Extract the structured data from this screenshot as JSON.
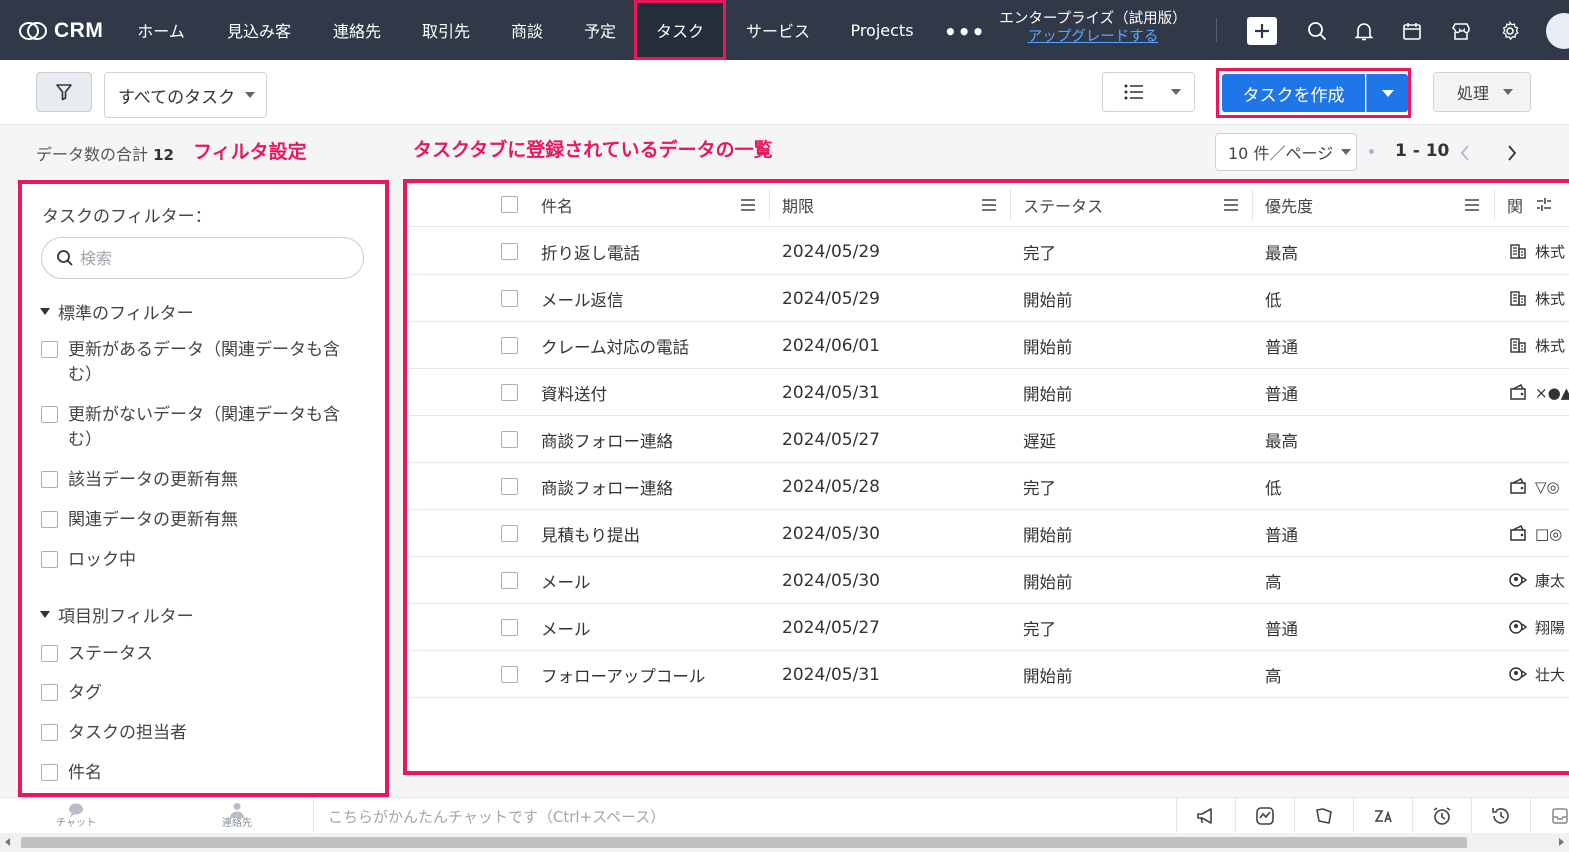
{
  "app": {
    "logo_text": "CRM"
  },
  "nav": {
    "items": [
      {
        "label": "ホーム"
      },
      {
        "label": "見込み客"
      },
      {
        "label": "連絡先"
      },
      {
        "label": "取引先"
      },
      {
        "label": "商談"
      },
      {
        "label": "予定"
      },
      {
        "label": "タスク",
        "active": true
      },
      {
        "label": "サービス"
      },
      {
        "label": "Projects"
      }
    ],
    "more_label": "•••",
    "trial_label": "エンタープライズ（試用版）",
    "upgrade_link": "アップグレードする",
    "icons": [
      "plus-icon",
      "search-icon",
      "bell-icon",
      "calendar-icon",
      "store-icon",
      "gear-icon"
    ]
  },
  "toolbar": {
    "view_select": "すべてのタスク",
    "create_button": "タスクを作成",
    "action_button": "処理"
  },
  "summary": {
    "total_label": "データ数の合計",
    "total_count": "12",
    "annotation_filter": "フィルタ設定",
    "annotation_list": "タスクタブに登録されているデータの一覧"
  },
  "pagination": {
    "per_page": "10 件／ページ",
    "range": "1 - 10"
  },
  "filter_panel": {
    "title": "タスクのフィルター：",
    "search_placeholder": "検索",
    "section_standard": "標準のフィルター",
    "standard_items": [
      "更新があるデータ（関連データも含む）",
      "更新がないデータ（関連データも含む）",
      "該当データの更新有無",
      "関連データの更新有無",
      "ロック中"
    ],
    "section_field": "項目別フィルター",
    "field_items": [
      "ステータス",
      "タグ",
      "タスクの担当者",
      "件名"
    ]
  },
  "grid": {
    "columns": [
      "件名",
      "期限",
      "ステータス",
      "優先度",
      "関"
    ],
    "rows": [
      {
        "subject": "折り返し電話",
        "due": "2024/05/29",
        "status": "完了",
        "priority": "最高",
        "rel_icon": "building-icon",
        "rel_text": "株式"
      },
      {
        "subject": "メール返信",
        "due": "2024/05/29",
        "status": "開始前",
        "priority": "低",
        "rel_icon": "building-icon",
        "rel_text": "株式"
      },
      {
        "subject": "クレーム対応の電話",
        "due": "2024/06/01",
        "status": "開始前",
        "priority": "普通",
        "rel_icon": "building-icon",
        "rel_text": "株式"
      },
      {
        "subject": "資料送付",
        "due": "2024/05/31",
        "status": "開始前",
        "priority": "普通",
        "rel_icon": "wallet-icon",
        "rel_text": "×●▲"
      },
      {
        "subject": "商談フォロー連絡",
        "due": "2024/05/27",
        "status": "遅延",
        "priority": "最高",
        "rel_icon": "",
        "rel_text": ""
      },
      {
        "subject": "商談フォロー連絡",
        "due": "2024/05/28",
        "status": "完了",
        "priority": "低",
        "rel_icon": "wallet-icon",
        "rel_text": "▽◎"
      },
      {
        "subject": "見積もり提出",
        "due": "2024/05/30",
        "status": "開始前",
        "priority": "普通",
        "rel_icon": "wallet-icon",
        "rel_text": "□◎"
      },
      {
        "subject": "メール",
        "due": "2024/05/30",
        "status": "開始前",
        "priority": "高",
        "rel_icon": "contact-icon",
        "rel_text": "康太"
      },
      {
        "subject": "メール",
        "due": "2024/05/27",
        "status": "完了",
        "priority": "普通",
        "rel_icon": "contact-icon",
        "rel_text": "翔陽"
      },
      {
        "subject": "フォローアップコール",
        "due": "2024/05/31",
        "status": "開始前",
        "priority": "高",
        "rel_icon": "contact-icon",
        "rel_text": "壮大"
      }
    ]
  },
  "bottom_bar": {
    "chat_label": "チャット",
    "contacts_label": "連絡先",
    "chat_placeholder": "こちらがかんたんチャットです（Ctrl+スペース）"
  },
  "colors": {
    "nav_bg": "#313949",
    "accent": "#1e76e8",
    "highlight": "#e8185b"
  }
}
